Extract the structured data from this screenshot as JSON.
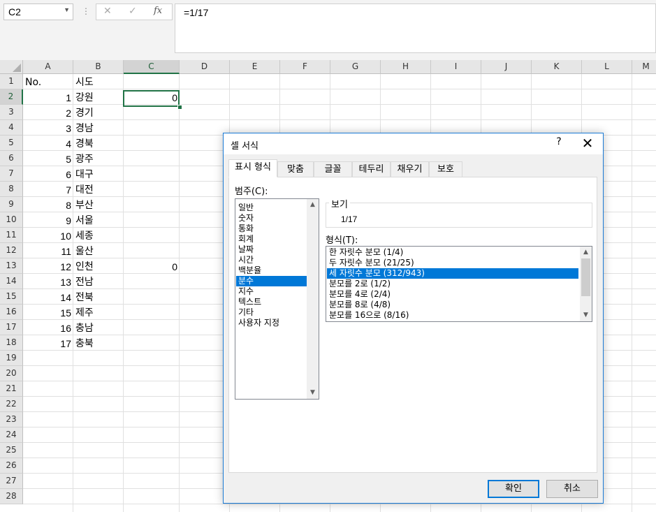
{
  "formula_bar": {
    "name_box": "C2",
    "dots_icon": "⋮",
    "cancel_icon": "✕",
    "enter_icon": "✓",
    "function_icon": "fx",
    "formula": "=1/17"
  },
  "sheet": {
    "columns": [
      "A",
      "B",
      "C",
      "D",
      "E",
      "F",
      "G",
      "H",
      "I",
      "J",
      "K",
      "L",
      "M"
    ],
    "selected_column": "C",
    "rows": [
      "1",
      "2",
      "3",
      "4",
      "5",
      "6",
      "7",
      "8",
      "9",
      "10",
      "11",
      "12",
      "13",
      "14",
      "15",
      "16",
      "17",
      "18",
      "19",
      "20",
      "21",
      "22",
      "23",
      "24",
      "25",
      "26",
      "27",
      "28"
    ],
    "selected_row": "2",
    "header_row": {
      "a": "No.",
      "b": "시도"
    },
    "data": [
      {
        "a": "1",
        "b": "강원"
      },
      {
        "a": "2",
        "b": "경기"
      },
      {
        "a": "3",
        "b": "경남"
      },
      {
        "a": "4",
        "b": "경북"
      },
      {
        "a": "5",
        "b": "광주"
      },
      {
        "a": "6",
        "b": "대구"
      },
      {
        "a": "7",
        "b": "대전"
      },
      {
        "a": "8",
        "b": "부산"
      },
      {
        "a": "9",
        "b": "서울"
      },
      {
        "a": "10",
        "b": "세종"
      },
      {
        "a": "11",
        "b": "울산"
      },
      {
        "a": "12",
        "b": "인천"
      },
      {
        "a": "13",
        "b": "전남"
      },
      {
        "a": "14",
        "b": "전북"
      },
      {
        "a": "15",
        "b": "제주"
      },
      {
        "a": "16",
        "b": "충남"
      },
      {
        "a": "17",
        "b": "충북"
      }
    ],
    "c2_value": "0",
    "c13_value": "0"
  },
  "dialog": {
    "title": "셀 서식",
    "help": "?",
    "close": "✕",
    "tabs": [
      "표시 형식",
      "맞춤",
      "글꼴",
      "테두리",
      "채우기",
      "보호"
    ],
    "active_tab": "표시 형식",
    "category_label": "범주(C):",
    "categories": [
      "일반",
      "숫자",
      "통화",
      "회계",
      "날짜",
      "시간",
      "백분율",
      "분수",
      "지수",
      "텍스트",
      "기타",
      "사용자 지정"
    ],
    "selected_category": "분수",
    "preview_label": "보기",
    "preview_value": "1/17",
    "type_label": "형식(T):",
    "types": [
      "한 자릿수 분모 (1/4)",
      "두 자릿수 분모 (21/25)",
      "세 자릿수 분모 (312/943)",
      "분모를 2로 (1/2)",
      "분모를 4로 (2/4)",
      "분모를 8로 (4/8)",
      "분모를 16으로 (8/16)"
    ],
    "selected_type": "세 자릿수 분모 (312/943)",
    "ok_label": "확인",
    "cancel_label": "취소"
  }
}
